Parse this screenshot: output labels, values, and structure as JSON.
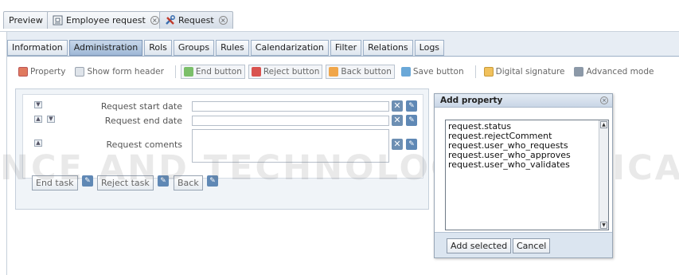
{
  "doc_tabs": [
    {
      "label": "Preview",
      "icon": "",
      "closable": false
    },
    {
      "label": "Employee request",
      "icon": "document-icon",
      "closable": true
    },
    {
      "label": "Request",
      "icon": "tools-icon",
      "closable": true
    }
  ],
  "sub_tabs": [
    "Information",
    "Administration",
    "Rols",
    "Groups",
    "Rules",
    "Calendarization",
    "Filter",
    "Relations",
    "Logs"
  ],
  "active_sub_tab": "Administration",
  "toolbar": {
    "property": "Property",
    "show_form_header": "Show form header",
    "end_button": "End button",
    "reject_button": "Reject button",
    "back_button": "Back button",
    "save_button": "Save button",
    "digital_signature": "Digital signature",
    "advanced_mode": "Advanced mode"
  },
  "form": {
    "fields": [
      {
        "label": "Request start date"
      },
      {
        "label": "Request end date"
      },
      {
        "label": "Request coments"
      }
    ],
    "buttons": {
      "end_task": "End task",
      "reject_task": "Reject task",
      "back": "Back"
    }
  },
  "modal": {
    "title": "Add property",
    "properties": [
      "request.status",
      "request.rejectComment",
      "request.user_who_requests",
      "request.user_who_approves",
      "request.user_who_validates"
    ],
    "add_selected": "Add selected",
    "cancel": "Cancel"
  },
  "watermark": {
    "line": "NCE AND TECHNOLOGY PUBLICATIONS"
  },
  "colors": {
    "active_subtab": "#a8bfdb",
    "panel_bg": "#e7edf4",
    "action_icon": "#6d8fb3"
  }
}
